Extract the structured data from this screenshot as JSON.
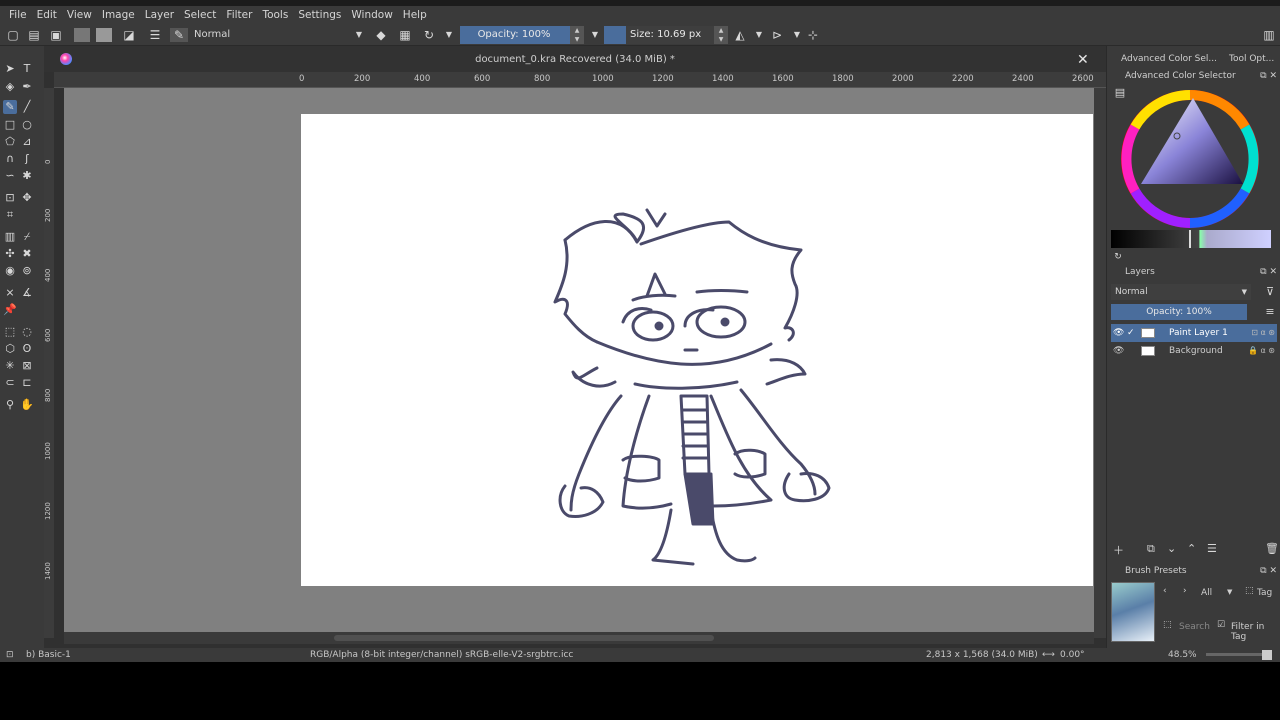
{
  "menu": [
    "File",
    "Edit",
    "View",
    "Image",
    "Layer",
    "Select",
    "Filter",
    "Tools",
    "Settings",
    "Window",
    "Help"
  ],
  "toolbar": {
    "blend_mode": "Normal",
    "opacity_label": "Opacity: 100%",
    "size_label": "Size: 10.69 px"
  },
  "document": {
    "title": "document_0.kra Recovered (34.0 MiB) *",
    "close_glyph": "✕"
  },
  "ruler_h": [
    "0",
    "200",
    "400",
    "600",
    "800",
    "1000",
    "1200",
    "1400",
    "1600",
    "1800",
    "2000",
    "2200",
    "2400",
    "2600"
  ],
  "ruler_v": [
    "0",
    "200",
    "400",
    "600",
    "800",
    "1000",
    "1200",
    "1400"
  ],
  "dock": {
    "tab_color": "Advanced Color Sel...",
    "tab_tool": "Tool Opt...",
    "color_panel_title": "Advanced Color Selector",
    "layers_title": "Layers",
    "layers_blend": "Normal",
    "layers_opacity": "Opacity:  100%",
    "layers": [
      {
        "name": "Paint Layer 1",
        "selected": true
      },
      {
        "name": "Background",
        "selected": false
      }
    ],
    "brush_presets_title": "Brush Presets",
    "preset_filter": "All",
    "preset_tag": "Tag",
    "search_placeholder": "Search",
    "filter_in_tag": "Filter in Tag"
  },
  "status": {
    "brush": "b) Basic-1",
    "color_profile": "RGB/Alpha (8-bit integer/channel)  sRGB-elle-V2-srgbtrc.icc",
    "dimensions": "2,813 x 1,568 (34.0 MiB)",
    "rotation": "0.00°",
    "zoom": "48.5%"
  },
  "colors": {
    "accent": "#4a6d9c",
    "panel": "#3a3a3a",
    "canvas_bg": "#808080",
    "stroke": "#4a4a6a"
  }
}
